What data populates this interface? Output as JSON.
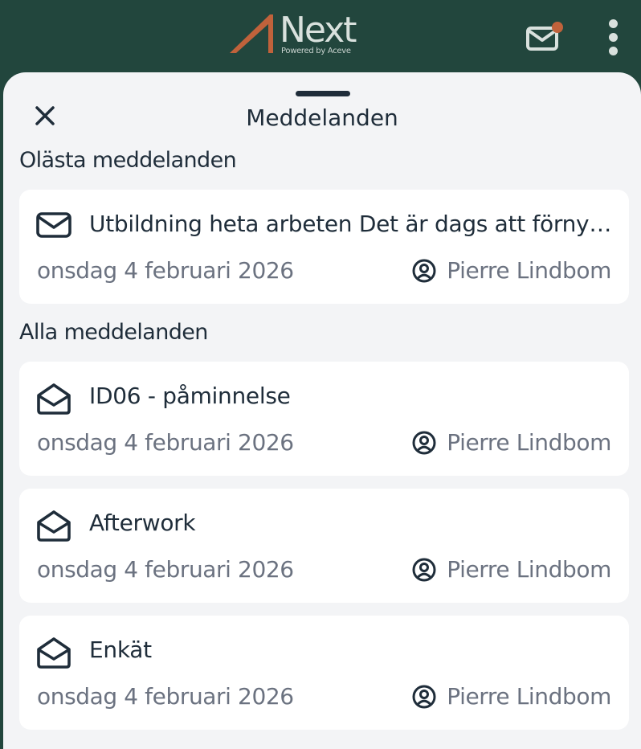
{
  "header": {
    "logo_word": "Next",
    "logo_tagline": "Powered by Aceve",
    "accent_color": "#c0623b",
    "background_color": "#22463d",
    "mail_icon": "mail-icon",
    "has_notification_dot": true,
    "menu_icon": "kebab-menu-icon"
  },
  "sheet": {
    "title": "Meddelanden",
    "close_icon": "close-icon"
  },
  "sections": [
    {
      "heading": "Olästa meddelanden",
      "messages": [
        {
          "subject": "Utbildning heta arbeten Det är dags att förnya ...",
          "date": "onsdag 4 februari 2026",
          "sender": "Pierre Lindbom",
          "icon": "envelope-closed-icon",
          "read": false
        }
      ]
    },
    {
      "heading": "Alla meddelanden",
      "messages": [
        {
          "subject": "ID06 - påminnelse",
          "date": "onsdag 4 februari 2026",
          "sender": "Pierre Lindbom",
          "icon": "envelope-open-icon",
          "read": true
        },
        {
          "subject": "Afterwork",
          "date": "onsdag 4 februari 2026",
          "sender": "Pierre Lindbom",
          "icon": "envelope-open-icon",
          "read": true
        },
        {
          "subject": "Enkät",
          "date": "onsdag 4 februari 2026",
          "sender": "Pierre Lindbom",
          "icon": "envelope-open-icon",
          "read": true
        }
      ]
    }
  ]
}
